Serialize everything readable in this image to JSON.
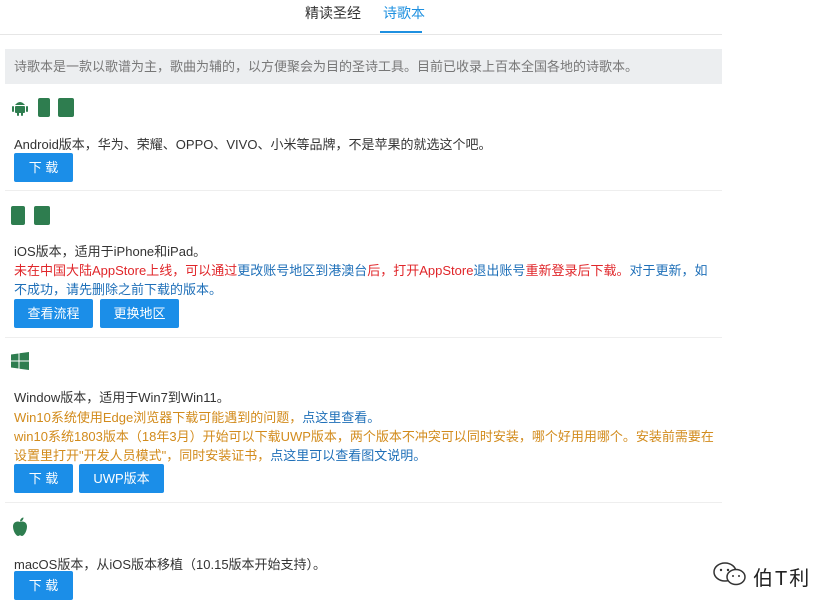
{
  "tabs": [
    {
      "label": "精读圣经",
      "active": false
    },
    {
      "label": "诗歌本",
      "active": true
    }
  ],
  "intro": "诗歌本是一款以歌谱为主，歌曲为辅的，以方便聚会为目的圣诗工具。目前已收录上百本全国各地的诗歌本。",
  "android": {
    "icons": [
      "android-icon",
      "phone-icon",
      "tablet-icon"
    ],
    "desc": "Android版本，华为、荣耀、OPPO、VIVO、小米等品牌，不是苹果的就选这个吧。",
    "download": "下 载"
  },
  "ios": {
    "icons": [
      "phone-icon",
      "tablet-icon"
    ],
    "desc": "iOS版本，适用于iPhone和iPad。",
    "note_part1": "未在中国大陆AppStore上线，可以通过",
    "note_link1": "更改账号地区到港澳台",
    "note_part2": "后，打开AppStore",
    "note_link2": "退出账号",
    "note_part3": "重新登录后下载。",
    "note_blue": "对于更新，如不成功，请先删除之前下载的版本。",
    "btn_flow": "查看流程",
    "btn_region": "更换地区"
  },
  "windows": {
    "icons": [
      "windows-icon"
    ],
    "desc": "Window版本，适用于Win7到Win11。",
    "note1": "Win10系统使用Edge浏览器下载可能遇到的问题，",
    "note1_link": "点这里查看。",
    "note2": "win10系统1803版本（18年3月）开始可以下载UWP版本，两个版本不冲突可以同时安装，哪个好用用哪个。安装前需要在设置里打开\"开发人员模式\"，同时安装证书，",
    "note2_link": "点这里可以查看图文说明。",
    "download": "下 载",
    "uwp": "UWP版本"
  },
  "mac": {
    "icons": [
      "apple-icon"
    ],
    "desc": "macOS版本，从iOS版本移植（10.15版本开始支持）。",
    "download": "下 载"
  },
  "watermark": {
    "text": "伯T利"
  },
  "colors": {
    "accent": "#1b8ee8",
    "icon_green": "#2e7d4f",
    "red": "#e0262a",
    "orange": "#d28b1c",
    "link_blue": "#1e6fb8"
  }
}
